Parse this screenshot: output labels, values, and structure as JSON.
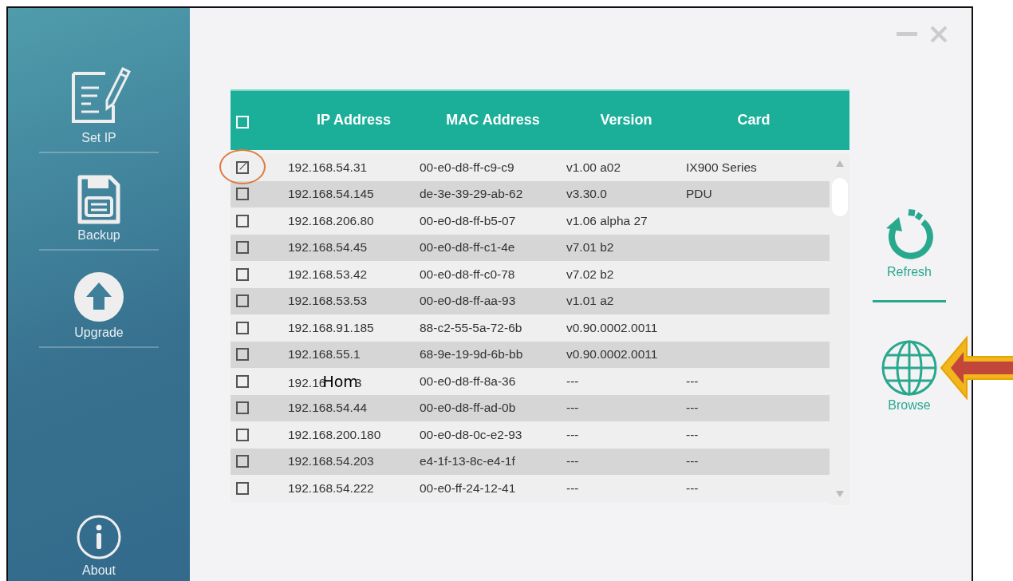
{
  "sidebar": {
    "items": [
      {
        "kind": "setip",
        "label": "Set IP"
      },
      {
        "kind": "backup",
        "label": "Backup"
      },
      {
        "kind": "upgrade",
        "label": "Upgrade"
      }
    ],
    "about": {
      "label": "About"
    }
  },
  "table": {
    "columns": [
      "IP Address",
      "MAC Address",
      "Version",
      "Card"
    ],
    "select_all": {
      "checked": false
    },
    "rows": [
      {
        "checked": true,
        "highlighted": true,
        "ip": "192.168.54.31",
        "mac": "00-e0-d8-ff-c9-c9",
        "version": "v1.00 a02",
        "card": "IX900 Series"
      },
      {
        "checked": false,
        "ip": "192.168.54.145",
        "mac": "de-3e-39-29-ab-62",
        "version": "v3.30.0",
        "card": "PDU"
      },
      {
        "checked": false,
        "ip": "192.168.206.80",
        "mac": "00-e0-d8-ff-b5-07",
        "version": "v1.06 alpha 27"
      },
      {
        "checked": false,
        "ip": "192.168.54.45",
        "mac": "00-e0-d8-ff-c1-4e",
        "version": "v7.01 b2"
      },
      {
        "checked": false,
        "ip": "192.168.53.42",
        "mac": "00-e0-d8-ff-c0-78",
        "version": "v7.02 b2"
      },
      {
        "checked": false,
        "ip": "192.168.53.53",
        "mac": "00-e0-d8-ff-aa-93",
        "version": "v1.01 a2"
      },
      {
        "checked": false,
        "ip": "192.168.91.185",
        "mac": "88-c2-55-5a-72-6b",
        "version": "v0.90.0002.0011"
      },
      {
        "checked": false,
        "ip": "192.168.55.1",
        "mac": "68-9e-19-9d-6b-bb",
        "version": "v0.90.0002.0011"
      },
      {
        "checked": false,
        "ip": "192.16",
        "overlay": "Hom",
        "ip_tail": "3",
        "mac": "00-e0-d8-ff-8a-36",
        "version": "---",
        "card": "---"
      },
      {
        "checked": false,
        "ip": "192.168.54.44",
        "mac": "00-e0-d8-ff-ad-0b",
        "version": "---",
        "card": "---"
      },
      {
        "checked": false,
        "ip": "192.168.200.180",
        "mac": "00-e0-d8-0c-e2-93",
        "version": "---",
        "card": "---"
      },
      {
        "checked": false,
        "ip": "192.168.54.203",
        "mac": "e4-1f-13-8c-e4-1f",
        "version": "---",
        "card": "---"
      },
      {
        "checked": false,
        "ip": "192.168.54.222",
        "mac": "00-e0-ff-24-12-41",
        "version": "---",
        "card": "---"
      }
    ]
  },
  "actions": [
    {
      "kind": "refresh",
      "label": "Refresh"
    },
    {
      "kind": "browse",
      "label": "Browse",
      "pointed": true
    }
  ]
}
